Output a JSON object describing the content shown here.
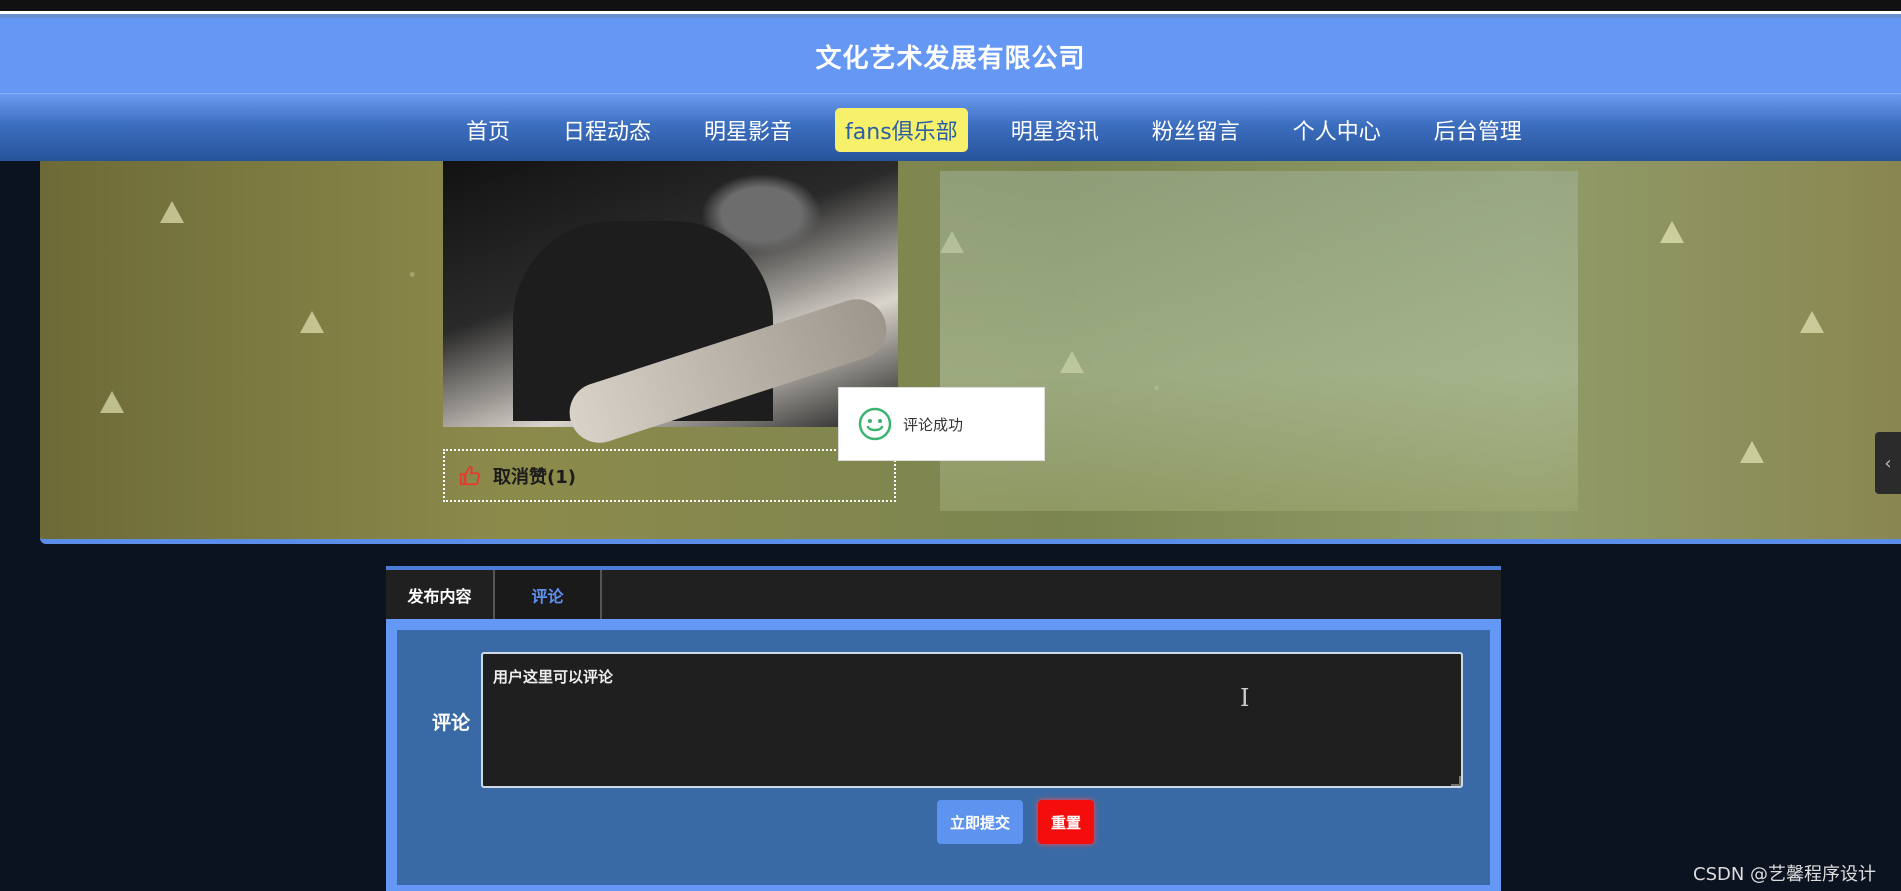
{
  "header": {
    "site_title": "文化艺术发展有限公司"
  },
  "nav": {
    "items": [
      {
        "label": "首页",
        "active": false
      },
      {
        "label": "日程动态",
        "active": false
      },
      {
        "label": "明星影音",
        "active": false
      },
      {
        "label": "fans俱乐部",
        "active": true
      },
      {
        "label": "明星资讯",
        "active": false
      },
      {
        "label": "粉丝留言",
        "active": false
      },
      {
        "label": "个人中心",
        "active": false
      },
      {
        "label": "后台管理",
        "active": false
      }
    ]
  },
  "post": {
    "like_label": "取消赞(1)",
    "like_icon": "thumbs-up-icon"
  },
  "toast": {
    "text": "评论成功",
    "icon": "smile-icon"
  },
  "side_tab": {
    "glyph": "‹"
  },
  "comment_panel": {
    "tabs": [
      {
        "label": "发布内容",
        "active": false
      },
      {
        "label": "评论",
        "active": true
      }
    ],
    "field_label": "评论",
    "textarea_value": "用户这里可以评论",
    "submit_label": "立即提交",
    "reset_label": "重置"
  },
  "cursor_glyph": "I",
  "watermark": "CSDN @艺馨程序设计",
  "colors": {
    "header_blue": "#6597f5",
    "active_nav": "#f7f06a",
    "submit_blue": "#5e93f0",
    "reset_red": "#f50d0d"
  }
}
